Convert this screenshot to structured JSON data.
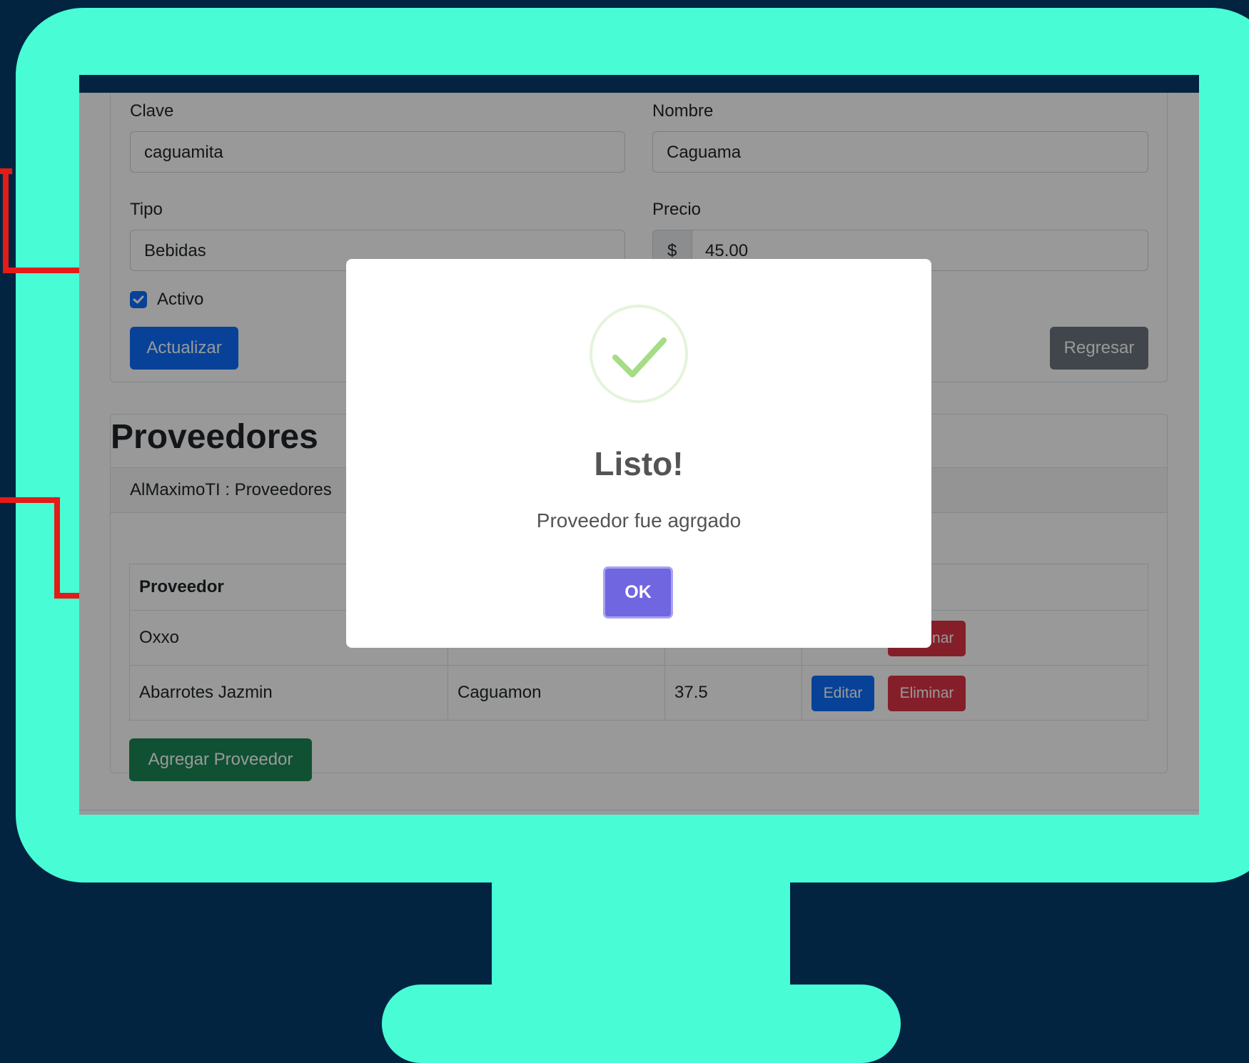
{
  "form": {
    "clave_label": "Clave",
    "clave_value": "caguamita",
    "nombre_label": "Nombre",
    "nombre_value": "Caguama",
    "tipo_label": "Tipo",
    "tipo_value": "Bebidas",
    "precio_label": "Precio",
    "precio_prefix": "$",
    "precio_value": "45.00",
    "activo_label": "Activo",
    "actualizar_label": "Actualizar",
    "regresar_label": "Regresar"
  },
  "proveedores": {
    "title": "Proveedores",
    "breadcrumb": "AlMaximoTI : Proveedores",
    "columns": [
      "Proveedor"
    ],
    "rows": [
      {
        "proveedor": "Oxxo",
        "producto": "",
        "precio": "",
        "eliminar_label": "Eliminar"
      },
      {
        "proveedor": "Abarrotes Jazmin",
        "producto": "Caguamon",
        "precio": "37.5",
        "editar_label": "Editar",
        "eliminar_label": "Eliminar"
      }
    ],
    "add_label": "Agregar Proveedor"
  },
  "modal": {
    "title": "Listo!",
    "text": "Proveedor fue agrgado",
    "ok_label": "OK",
    "icon": "success-check-icon"
  },
  "colors": {
    "bezel": "#48FDD6",
    "background": "#022440",
    "accent_line": "#E41B17",
    "primary": "#0d6efd",
    "secondary": "#6c757d",
    "success": "#198754",
    "danger": "#dc3545",
    "confirm": "#7066e0"
  }
}
